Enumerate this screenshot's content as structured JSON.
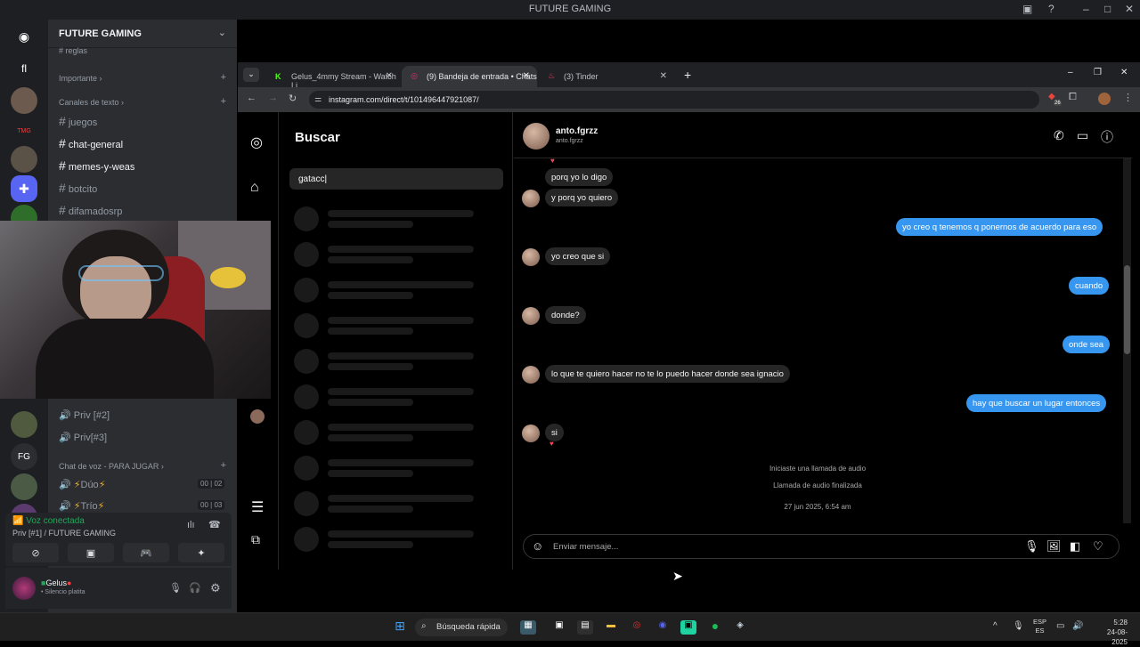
{
  "discord": {
    "window_title": "FUTURE GAMING",
    "server_name": "FUTURE GAMING",
    "server_rail": [
      "TMG"
    ],
    "top_channel": "reglas",
    "categories": {
      "importante": "Importante",
      "text": "Canales de texto",
      "voice": "Chat de voz - PARA JUGAR"
    },
    "text_channels": [
      "juegos",
      "chat-general",
      "memes-y-weas",
      "botcito",
      "difamadosrp"
    ],
    "voice_channels": [
      "Priv [#2]",
      "Priv[#3]"
    ],
    "voice_game_channels": [
      {
        "name": "Dúo",
        "a": "00",
        "b": "02"
      },
      {
        "name": "Trío",
        "a": "00",
        "b": "03"
      }
    ],
    "voice_status": "Voz conectada",
    "voice_location": "Priv [#1] / FUTURE GAMING",
    "user_name": "Gelus",
    "user_status": "Silencio platita"
  },
  "browser": {
    "tabs": [
      {
        "label": "Gelus_4mmy Stream - Watch Li",
        "active": false
      },
      {
        "label": "(9) Bandeja de entrada • Chats",
        "active": true
      },
      {
        "label": "(3) Tinder",
        "active": false
      }
    ],
    "url": "instagram.com/direct/t/101496447921087/",
    "ext_badge": "26"
  },
  "instagram": {
    "search_title": "Buscar",
    "search_value": "gatacc",
    "contact_name": "anto.fgrzz",
    "contact_handle": "anto.fgrzz",
    "messages": [
      {
        "side": "left",
        "text": "porq yo lo digo"
      },
      {
        "side": "left",
        "text": "y porq yo quiero"
      },
      {
        "side": "right",
        "text": "yo creo q tenemos q ponernos de acuerdo para eso"
      },
      {
        "side": "left",
        "text": "yo creo que si"
      },
      {
        "side": "right",
        "text": "cuando"
      },
      {
        "side": "left",
        "text": "donde?"
      },
      {
        "side": "right",
        "text": "onde sea"
      },
      {
        "side": "left",
        "text": "lo que te quiero hacer no te lo puedo hacer donde sea ignacio"
      },
      {
        "side": "right",
        "text": "hay que buscar un lugar entonces"
      },
      {
        "side": "left",
        "text": "si"
      }
    ],
    "system_1": "Iniciaste una llamada de audio",
    "system_2": "Llamada de audio finalizada",
    "system_date": "27 jun 2025, 6:54 am",
    "composer_placeholder": "Enviar mensaje..."
  },
  "taskbar": {
    "search_label": "Búsqueda rápida",
    "lang_1": "ESP",
    "lang_2": "ES",
    "time": "5:28",
    "date": "24-08-2025"
  },
  "colors": {
    "discord_bg": "#2b2d31",
    "ig_blue": "#3797f0",
    "voice_green": "#23a55a"
  }
}
